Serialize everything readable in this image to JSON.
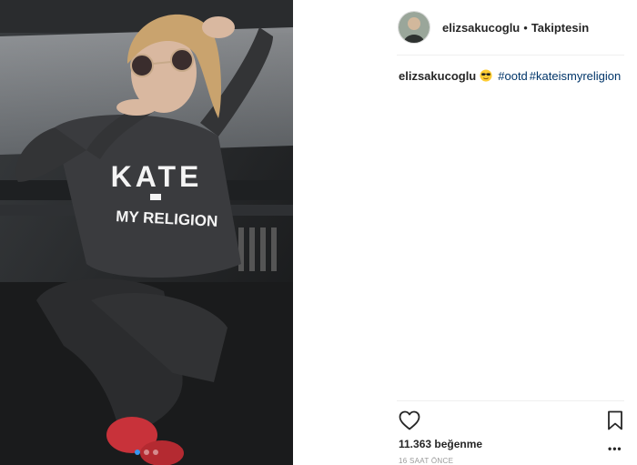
{
  "post": {
    "username": "elizsakucoglu",
    "separator": "•",
    "follow_status": "Takiptesin",
    "caption": {
      "username": "elizsakucoglu",
      "emoji": "sunglasses-emoji",
      "hashtags": [
        "#ootd",
        "#kateismyreligion"
      ]
    },
    "likes_text": "11.363 beğenme",
    "timestamp": "16 SAAT ÖNCE",
    "more_options": "•••",
    "carousel": {
      "count": 3,
      "active_index": 0
    }
  },
  "photo": {
    "shirt_line1": "KATE",
    "shirt_line2": "MY RELIGION",
    "colors": {
      "sweater": "#3a3b3e",
      "pants": "#2b2c2e",
      "shoes": "#c8323a",
      "hair": "#c9a36e",
      "skin": "#d9b8a0"
    }
  },
  "colors": {
    "accent": "#3897f0",
    "hashtag": "#003569",
    "text": "#262626",
    "muted": "#999999"
  }
}
